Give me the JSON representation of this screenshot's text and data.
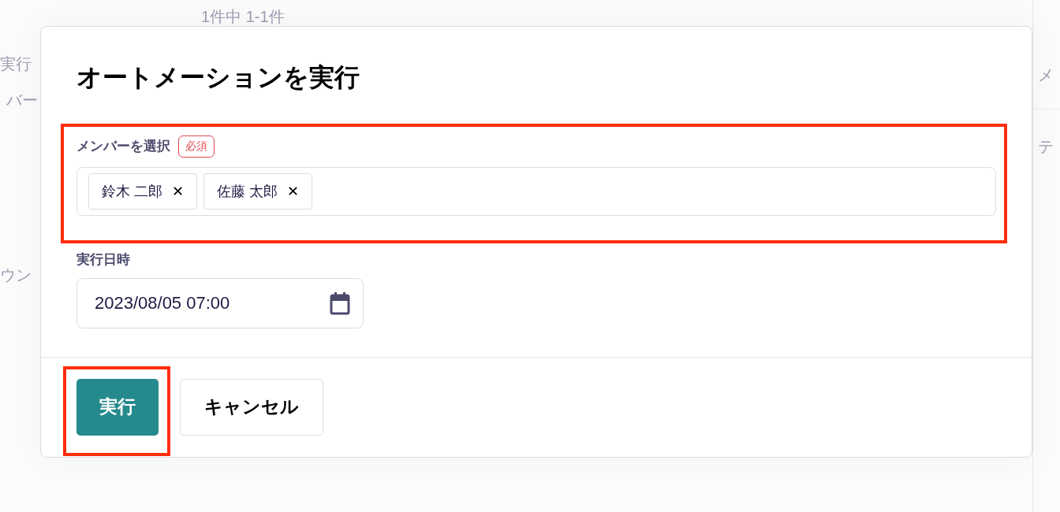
{
  "background": {
    "texts": [
      "1件中 1-1件",
      "実行",
      "バー",
      "ウン",
      "メ",
      "テ"
    ]
  },
  "dialog": {
    "title": "オートメーションを実行",
    "members": {
      "label": "メンバーを選択",
      "required_badge": "必須",
      "highlighted": true,
      "chips": [
        {
          "name": "鈴木 二郎",
          "remove": "✕"
        },
        {
          "name": "佐藤 太郎",
          "remove": "✕"
        }
      ]
    },
    "datetime": {
      "label": "実行日時",
      "value": "2023/08/05 07:00"
    },
    "buttons": [
      {
        "label": "実行",
        "kind": "primary",
        "highlighted": true
      },
      {
        "label": "キャンセル",
        "kind": "secondary",
        "highlighted": false
      }
    ]
  }
}
